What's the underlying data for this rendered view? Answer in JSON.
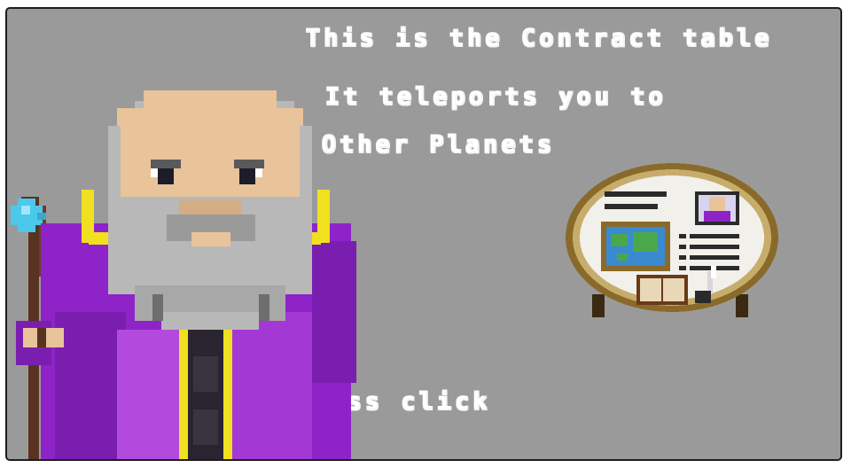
{
  "dialogue": {
    "line1": "This is the Contract table",
    "line2": "It teleports you to",
    "line3": "Other Planets"
  },
  "prompt": {
    "label": "Press click"
  },
  "colors": {
    "panel_bg": "#9a9a9a",
    "robe_purple": "#8e24c8",
    "robe_trim": "#f0e020",
    "skin": "#e9c39a",
    "beard": "#b8b8b8",
    "staff_crystal": "#4cc8ec",
    "table_rim": "#8a6a2a"
  }
}
